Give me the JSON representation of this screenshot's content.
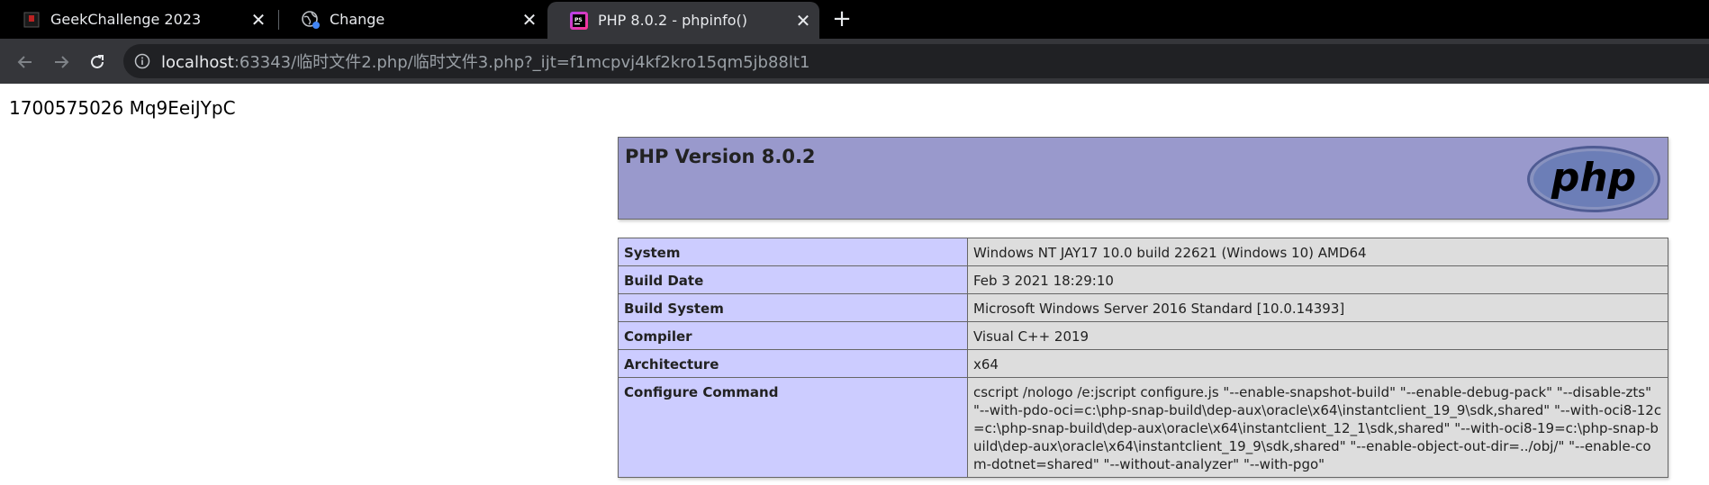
{
  "tabs": [
    {
      "label": "GeekChallenge 2023",
      "icon": "geek-favicon",
      "active": false
    },
    {
      "label": "Change",
      "icon": "globe-favicon",
      "active": false
    },
    {
      "label": "PHP 8.0.2 - phpinfo()",
      "icon": "phpstorm-favicon",
      "active": true
    }
  ],
  "address_bar": {
    "host": "localhost",
    "rest": ":63343/临时文件2.php/临时文件3.php?_ijt=f1mcpvj4kf2kro15qm5jb88lt1"
  },
  "page": {
    "echo_text": "1700575026 Mq9EeiJYpC",
    "php_version_title": "PHP Version 8.0.2",
    "logo_text": "php",
    "info_rows": [
      {
        "key": "System",
        "value": "Windows NT JAY17 10.0 build 22621 (Windows 10) AMD64"
      },
      {
        "key": "Build Date",
        "value": "Feb 3 2021 18:29:10"
      },
      {
        "key": "Build System",
        "value": "Microsoft Windows Server 2016 Standard [10.0.14393]"
      },
      {
        "key": "Compiler",
        "value": "Visual C++ 2019"
      },
      {
        "key": "Architecture",
        "value": "x64"
      },
      {
        "key": "Configure Command",
        "value": "cscript /nologo /e:jscript configure.js \"--enable-snapshot-build\" \"--enable-debug-pack\" \"--disable-zts\" \"--with-pdo-oci=c:\\php-snap-build\\dep-aux\\oracle\\x64\\instantclient_19_9\\sdk,shared\" \"--with-oci8-12c=c:\\php-snap-build\\dep-aux\\oracle\\x64\\instantclient_12_1\\sdk,shared\" \"--with-oci8-19=c:\\php-snap-build\\dep-aux\\oracle\\x64\\instantclient_19_9\\sdk,shared\" \"--enable-object-out-dir=../obj/\" \"--enable-com-dotnet=shared\" \"--without-analyzer\" \"--with-pgo\""
      }
    ]
  },
  "colors": {
    "header_bg": "#9999cc",
    "key_cell_bg": "#ccccff",
    "value_cell_bg": "#dddddd",
    "logo_bg": "#6c7eb7"
  }
}
